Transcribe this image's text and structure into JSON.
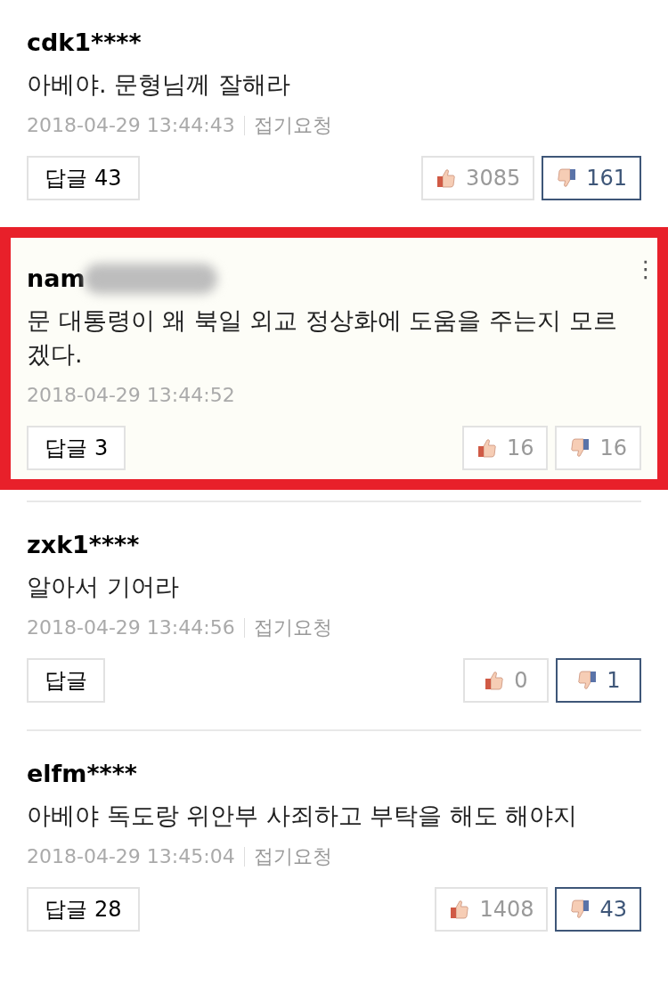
{
  "comments": [
    {
      "username": "cdk1****",
      "username_blurred": false,
      "highlighted": false,
      "text": "아베야. 문형님께 잘해라",
      "date": "2018-04-29 13:44:43",
      "fold_request": "접기요청",
      "reply_label": "답글",
      "reply_count": "43",
      "likes": "3085",
      "dislikes": "161",
      "liked": false,
      "disliked": true
    },
    {
      "username": "nam",
      "username_blurred": true,
      "highlighted": true,
      "text": "문 대통령이 왜 북일 외교 정상화에 도움을 주는지 모르겠다.",
      "date": "2018-04-29 13:44:52",
      "menu_icon": "⋮",
      "reply_label": "답글",
      "reply_count": "3",
      "likes": "16",
      "dislikes": "16",
      "liked": false,
      "disliked": false
    },
    {
      "username": "zxk1****",
      "username_blurred": false,
      "highlighted": false,
      "text": "알아서 기어라",
      "date": "2018-04-29 13:44:56",
      "fold_request": "접기요청",
      "reply_label": "답글",
      "likes": "0",
      "dislikes": "1",
      "liked": false,
      "disliked": true
    },
    {
      "username": "elfm****",
      "username_blurred": false,
      "highlighted": false,
      "text": "아베야 독도랑 위안부 사죄하고 부탁을 해도 해야지",
      "date": "2018-04-29 13:45:04",
      "fold_request": "접기요청",
      "reply_label": "답글",
      "reply_count": "28",
      "likes": "1408",
      "dislikes": "43",
      "liked": false,
      "disliked": true
    }
  ]
}
